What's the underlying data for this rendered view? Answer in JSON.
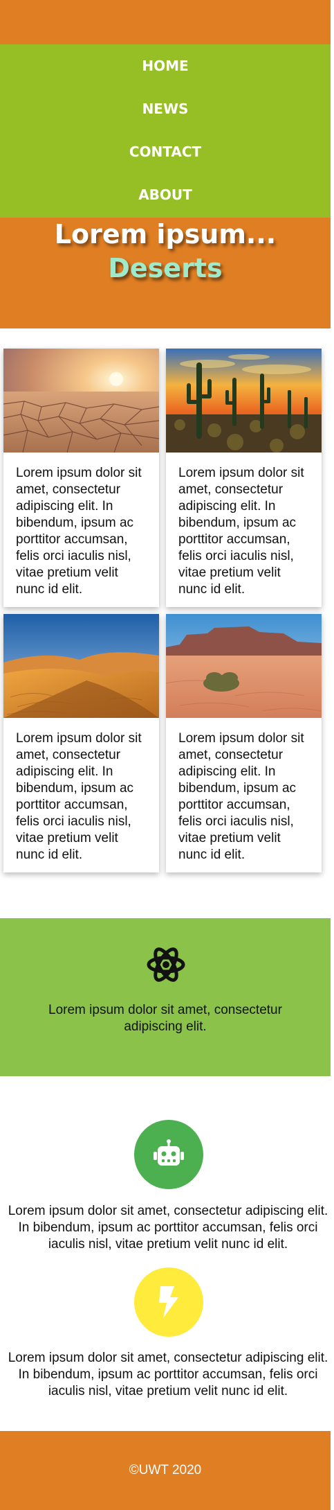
{
  "nav": {
    "items": [
      "HOME",
      "NEWS",
      "CONTACT",
      "ABOUT"
    ]
  },
  "hero": {
    "title": "Lorem ipsum...",
    "subtitle": "Deserts"
  },
  "cards": [
    {
      "image": "desert-cracked-earth-sunset",
      "text": "Lorem ipsum dolor sit amet, consectetur adipiscing elit. In bibendum, ipsum ac porttitor accumsan, felis orci iaculis nisl, vitae pretium velit nunc id elit."
    },
    {
      "image": "desert-cactus-sunset",
      "text": "Lorem ipsum dolor sit amet, consectetur adipiscing elit. In bibendum, ipsum ac porttitor accumsan, felis orci iaculis nisl, vitae pretium velit nunc id elit."
    },
    {
      "image": "sand-dunes",
      "text": "Lorem ipsum dolor sit amet, consectetur adipiscing elit. In bibendum, ipsum ac porttitor accumsan, felis orci iaculis nisl, vitae pretium velit nunc id elit."
    },
    {
      "image": "desert-mesa-bush",
      "text": "Lorem ipsum dolor sit amet, consectetur adipiscing elit. In bibendum, ipsum ac porttitor accumsan, felis orci iaculis nisl, vitae pretium velit nunc id elit."
    }
  ],
  "feature": {
    "icon": "atom-icon",
    "text": "Lorem ipsum dolor sit amet, consectetur adipiscing elit."
  },
  "blocks": [
    {
      "icon": "robot-icon",
      "color": "#4caf50",
      "text": "Lorem ipsum dolor sit amet, consectetur adipiscing elit. In bibendum, ipsum ac porttitor accumsan, felis orci iaculis nisl, vitae pretium velit nunc id elit."
    },
    {
      "icon": "lightning-bolt-icon",
      "color": "#ffeb3b",
      "text": "Lorem ipsum dolor sit amet, consectetur adipiscing elit. In bibendum, ipsum ac porttitor accumsan, felis orci iaculis nisl, vitae pretium velit nunc id elit."
    }
  ],
  "footer": {
    "text": "©UWT 2020"
  },
  "colors": {
    "header": "#e07e23",
    "nav": "#96be25",
    "feature": "#8bc34a",
    "footer": "#e07e23",
    "hero_subtitle": "#9eeacb"
  }
}
